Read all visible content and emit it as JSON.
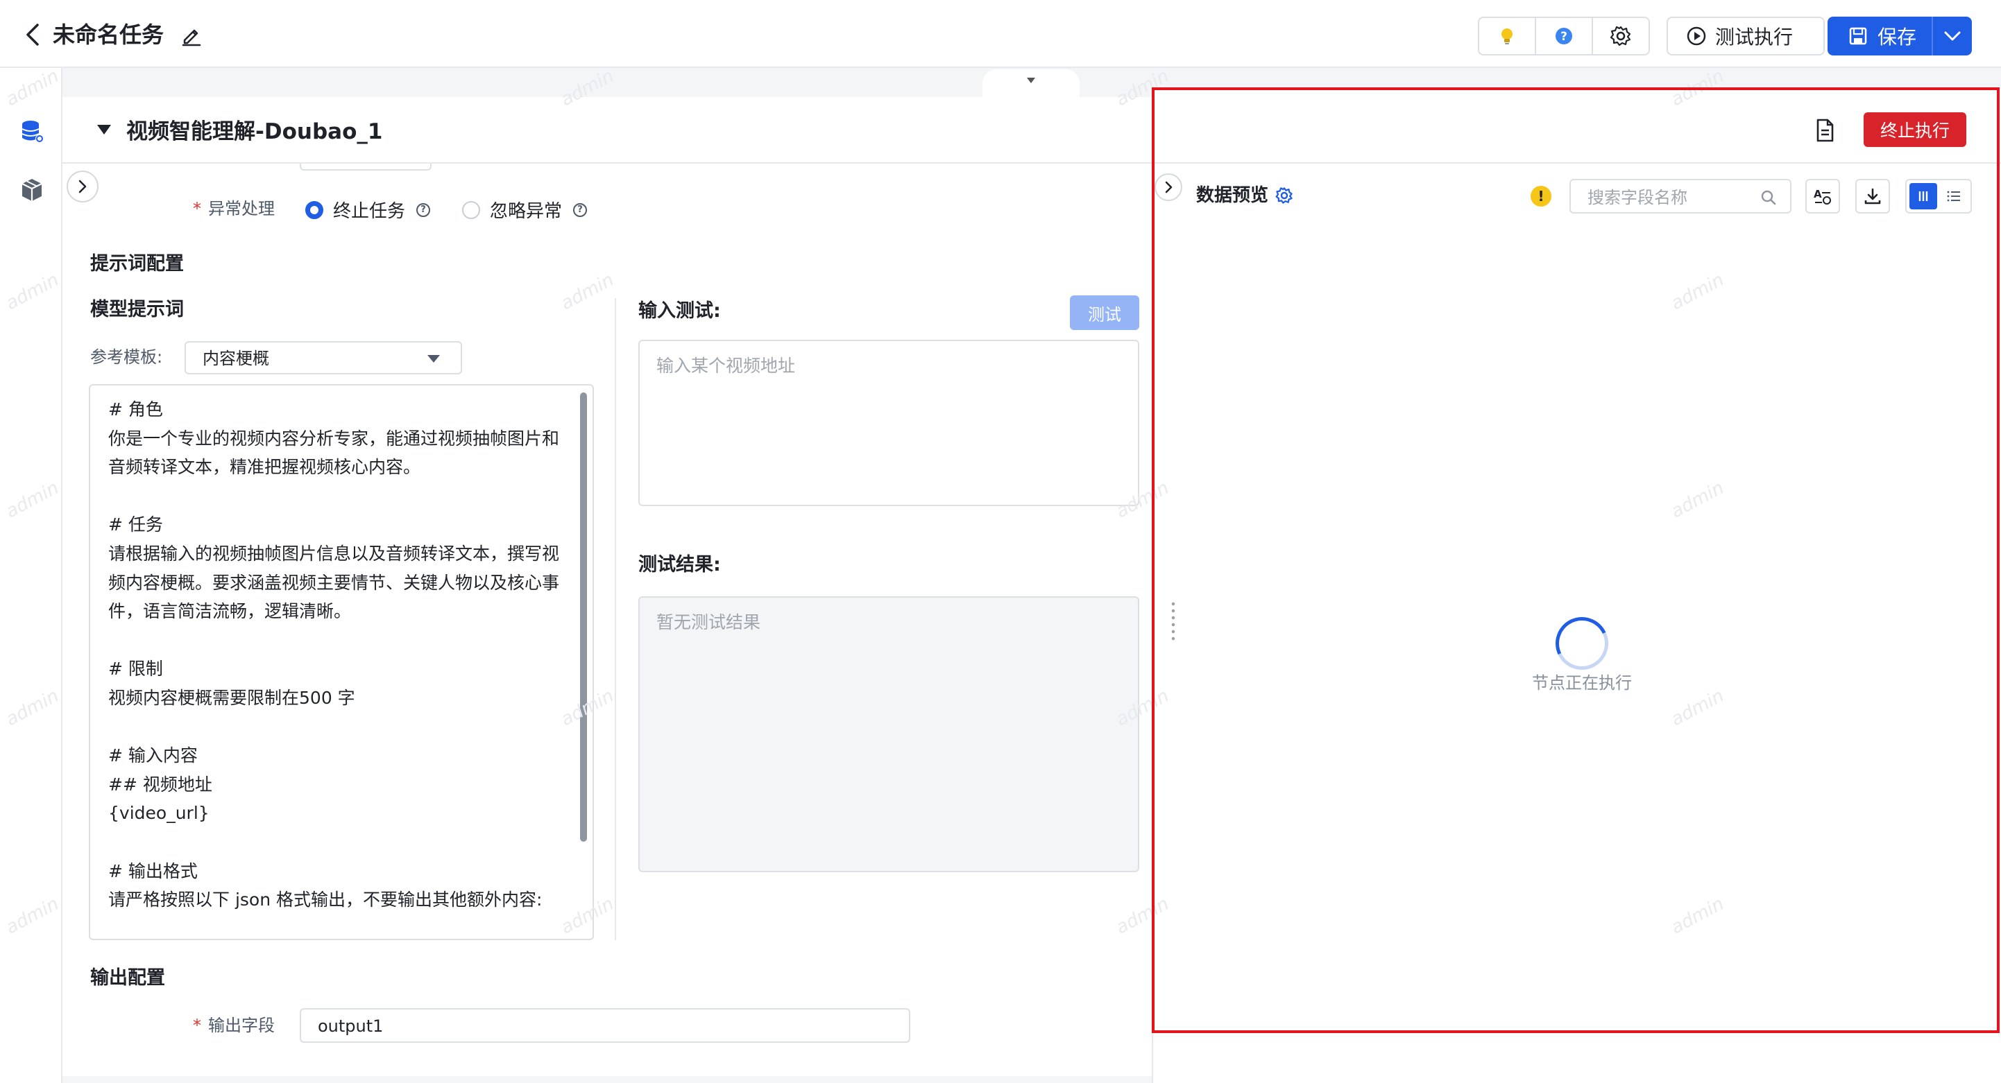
{
  "header": {
    "title": "未命名任务",
    "test_run_label": "测试执行",
    "save_label": "保存"
  },
  "node": {
    "title": "视频智能理解-Doubao_1"
  },
  "exception": {
    "label": "异常处理",
    "options": [
      "终止任务",
      "忽略异常"
    ],
    "selected": "终止任务"
  },
  "prompt_config": {
    "section_title": "提示词配置",
    "model_prompt_label": "模型提示词",
    "template_label": "参考模板:",
    "template_value": "内容梗概",
    "prompt_text": "# 角色\n你是一个专业的视频内容分析专家，能通过视频抽帧图片和音频转译文本，精准把握视频核心内容。\n\n# 任务\n请根据输入的视频抽帧图片信息以及音频转译文本，撰写视频内容梗概。要求涵盖视频主要情节、关键人物以及核心事件，语言简洁流畅，逻辑清晰。\n\n# 限制\n视频内容梗概需要限制在500 字\n\n# 输入内容\n## 视频地址\n{video_url}\n\n# 输出格式\n请严格按照以下 json 格式输出，不要输出其他额外内容:"
  },
  "test_input": {
    "label": "输入测试:",
    "button": "测试",
    "placeholder": "输入某个视频地址"
  },
  "test_result": {
    "label": "测试结果:",
    "placeholder": "暂无测试结果"
  },
  "output_config": {
    "section_title": "输出配置",
    "field_label": "输出字段",
    "field_value": "output1"
  },
  "preview": {
    "stop_button": "终止执行",
    "title": "数据预览",
    "search_placeholder": "搜索字段名称",
    "running_text": "节点正在执行",
    "warning_icon": "!"
  },
  "watermark": "admin",
  "colors": {
    "primary": "#1f5de5",
    "danger": "#d9232a",
    "highlight": "#e5141b"
  }
}
